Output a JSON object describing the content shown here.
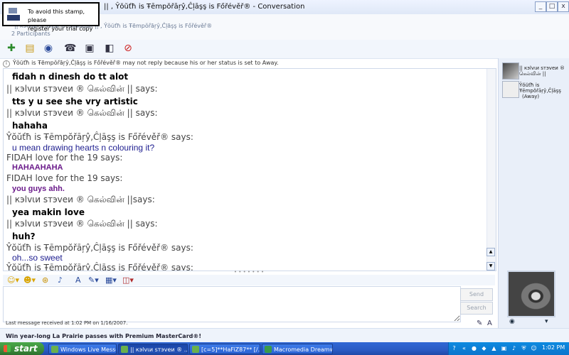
{
  "window": {
    "title": "|| , Ŷŏŭťħ is Ŧēmpŏřāŗŷ,Ĉļāşş is Főřévěř® - Conversation",
    "controls": {
      "minimize": "_",
      "maximize": "□",
      "close": "x"
    }
  },
  "stamp": {
    "line1": "To avoid this stamp, please",
    "line2": "register your trial copy"
  },
  "participants": {
    "names": "|| кэlvιи sтэveи ® கெல்வின் || , Ŷŏŭťħ is Ŧēmpŏřāŗŷ,Ĉļāşş is Főřévěř®",
    "count": "2 Participants"
  },
  "toolbar": {
    "icons": [
      "invite-icon",
      "send-files-icon",
      "video-icon",
      "call-icon",
      "activities-icon",
      "games-icon",
      "block-icon"
    ]
  },
  "status_notice": "Ŷŏŭťħ is Ŧēmpŏřāŗŷ,Ĉļāşş is Főřévěř® may not reply because his or her status is set to Away.",
  "conversation": [
    {
      "type": "body_comic",
      "text": "fidah n dinesh do tt alot"
    },
    {
      "type": "sender",
      "text": "|| кэlvιи sтэveи ®  கெல்வின்  || says:"
    },
    {
      "type": "body_comic",
      "text": "tts y u see she vry artistic"
    },
    {
      "type": "sender",
      "text": "|| кэlvιи sтэveи ®  கெல்வின்  || says:"
    },
    {
      "type": "body_comic",
      "text": "hahaha"
    },
    {
      "type": "sender",
      "text": "Ŷŏŭťħ is Ŧēmpŏřāŗŷ,Ĉļāşş is Főřévěř® says:"
    },
    {
      "type": "body_blue",
      "text": "u mean drawing hearts n colouring it?"
    },
    {
      "type": "sender",
      "text": "FIDAH    love for the 19 says:"
    },
    {
      "type": "body_purple",
      "text": "HAHAAHAHA"
    },
    {
      "type": "sender",
      "text": "FIDAH    love for the 19 says:"
    },
    {
      "type": "body_purple",
      "text": "you guys ahh."
    },
    {
      "type": "sender",
      "text": "|| кэlvιи sтэveи ®  கெல்வின்  ||says:"
    },
    {
      "type": "body_comic",
      "text": "yea makin love"
    },
    {
      "type": "sender",
      "text": "|| кэlvιи sтэveи ®  கெல்வின்  || says:"
    },
    {
      "type": "body_comic",
      "text": "huh?"
    },
    {
      "type": "sender",
      "text": "Ŷŏŭťħ is Ŧēmpŏřāŗŷ,Ĉļāşş is Főřévěř® says:"
    },
    {
      "type": "body_blue",
      "text": "oh...so sweet"
    },
    {
      "type": "sender",
      "text": "Ŷŏŭťħ is Ŧēmpŏřāŗŷ,Ĉļāşş is Főřévěř® says:"
    }
  ],
  "format_toolbar": {
    "icons": [
      "emoticon-icon",
      "wink-icon",
      "nudge-icon",
      "voice-clip-icon",
      "font-icon",
      "pencil-icon",
      "background-icon",
      "gift-icon"
    ]
  },
  "compose": {
    "text": ""
  },
  "buttons": {
    "send": "Send",
    "search": "Search"
  },
  "last_message": "Last message received at 1:02 PM on 1/16/2007.",
  "ad": "Win year-long La Prairie passes with Premium MasterCard®!",
  "contacts": [
    {
      "name_line1": "|| кэlvιи sтэveи ®",
      "name_line2": "கெல்வின் ||"
    },
    {
      "name_line1": "Ŷŏŭťħ is",
      "name_line2": "Ŧēmpŏřāŗŷ,Ĉļāşş",
      "status": "(Away)"
    }
  ],
  "taskbar": {
    "start": "start",
    "items": [
      {
        "label": "Windows Live Messen..."
      },
      {
        "label": "|| кэlvιи sтэveи ® ..."
      },
      {
        "label": "[c=5]**HaFiZ87** [/..."
      },
      {
        "label": "Macromedia Dreamw..."
      }
    ],
    "clock": "1:02 PM"
  },
  "colors": {
    "taskbar": "#2a5bc4",
    "start": "#3b8c3b",
    "tray": "#0e8ae0",
    "accent": "#1d1d8f"
  }
}
